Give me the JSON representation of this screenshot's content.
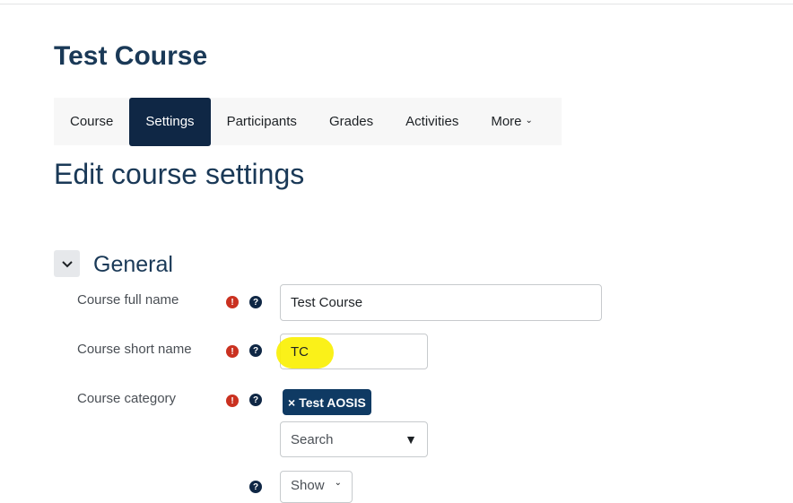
{
  "course": {
    "title": "Test Course"
  },
  "tabs": [
    {
      "label": "Course"
    },
    {
      "label": "Settings"
    },
    {
      "label": "Participants"
    },
    {
      "label": "Grades"
    },
    {
      "label": "Activities"
    },
    {
      "label": "More"
    }
  ],
  "page": {
    "heading": "Edit course settings"
  },
  "section": {
    "title": "General"
  },
  "fields": {
    "full_name": {
      "label": "Course full name",
      "value": "Test Course"
    },
    "short_name": {
      "label": "Course short name",
      "value": "TC"
    },
    "category": {
      "label": "Course category",
      "selected": "Test AOSIS",
      "search_placeholder": "Search"
    },
    "visibility": {
      "value": "Show"
    }
  },
  "icons": {
    "required": "exclamation-icon",
    "help": "question-icon"
  },
  "colors": {
    "primary": "#0f2745",
    "heading": "#1a3957",
    "required": "#ca3120",
    "highlight": "#f9f000"
  }
}
